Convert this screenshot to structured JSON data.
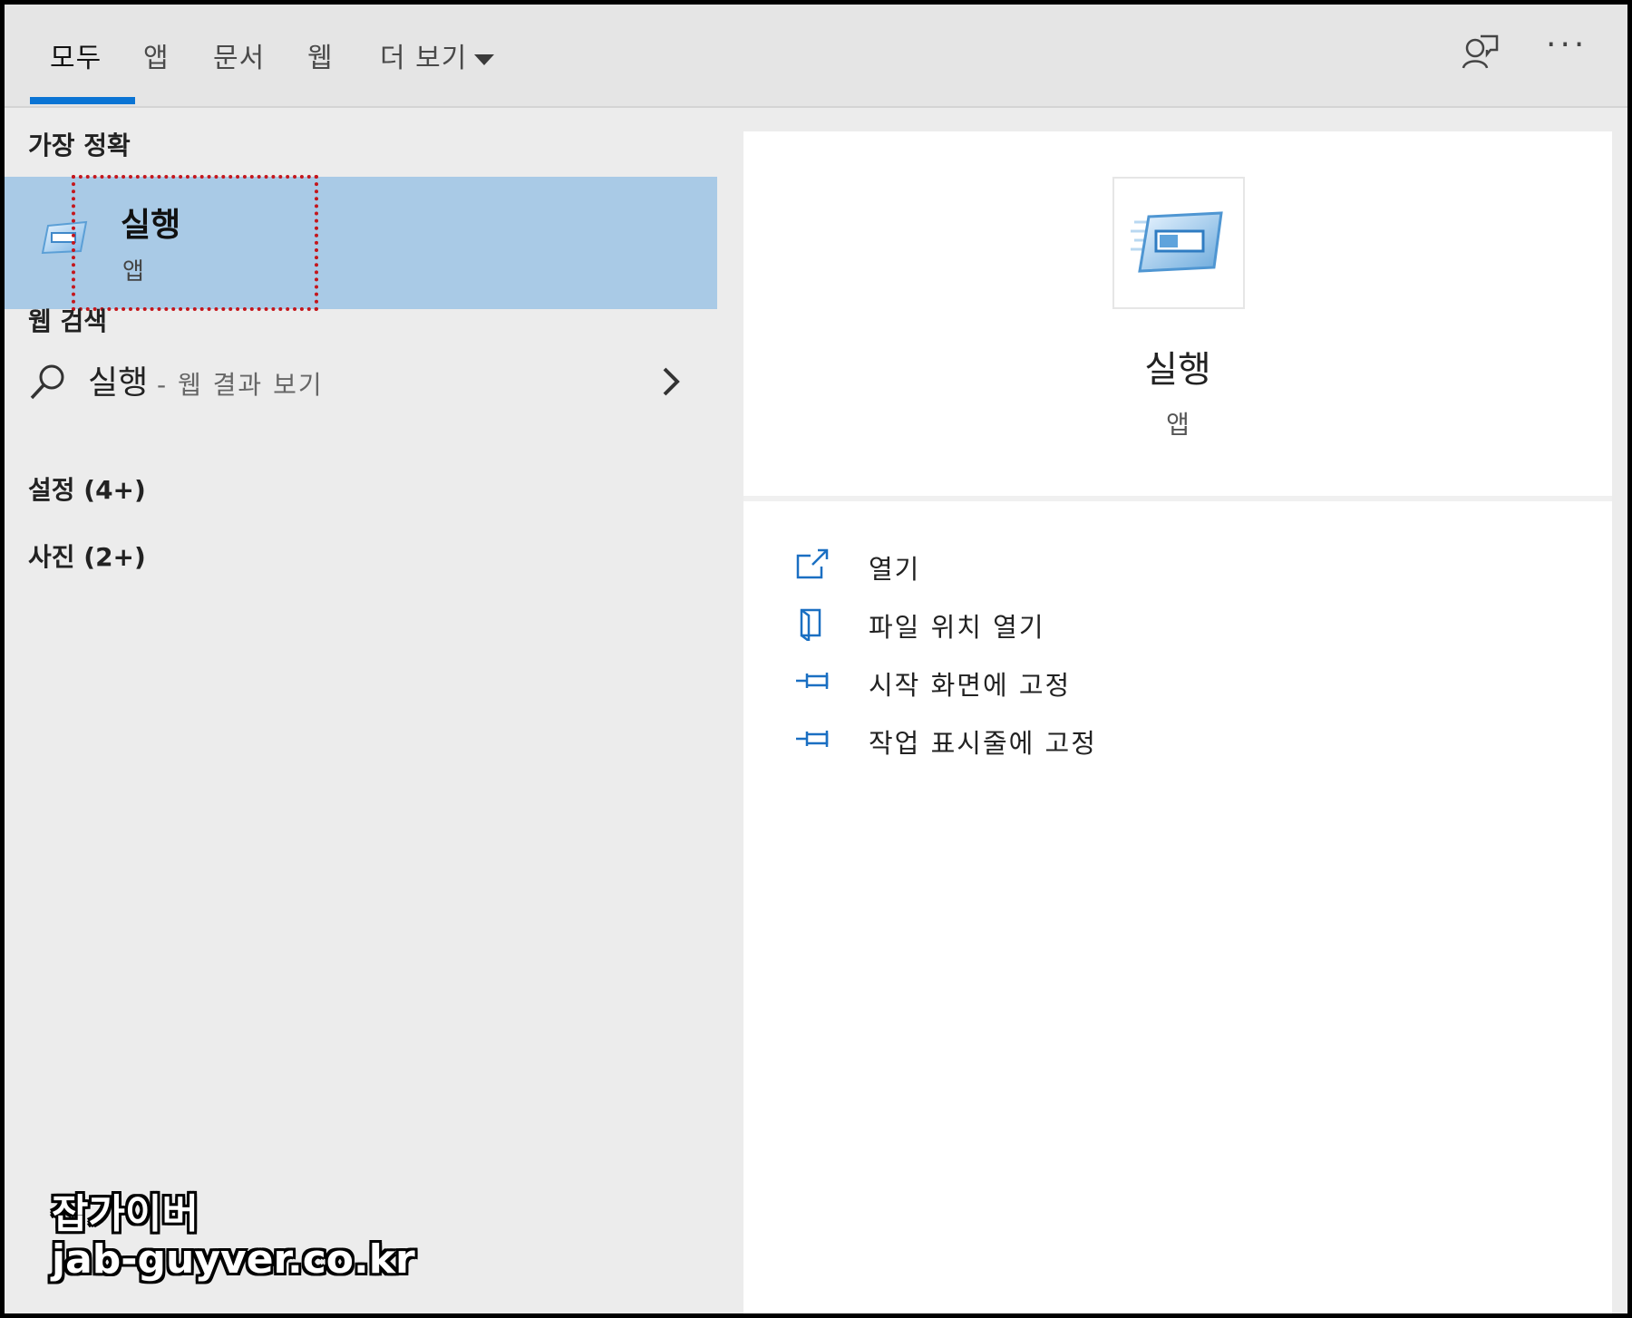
{
  "tabs": [
    {
      "label": "모두",
      "active": true
    },
    {
      "label": "앱",
      "active": false
    },
    {
      "label": "문서",
      "active": false
    },
    {
      "label": "웹",
      "active": false
    },
    {
      "label": "더 보기",
      "active": false
    }
  ],
  "toolbar": {
    "feedback_icon": "feedback-person-icon",
    "more_label": "···"
  },
  "left": {
    "best_match_heading": "가장 정확",
    "best_match": {
      "title": "실행",
      "subtitle": "앱",
      "icon": "run-app-icon"
    },
    "web_heading": "웹 검색",
    "web_search": {
      "query": "실행",
      "hint": "- 웹 결과 보기"
    },
    "groups": [
      {
        "label": "설정 (4+)"
      },
      {
        "label": "사진 (2+)"
      }
    ]
  },
  "right": {
    "title": "실행",
    "subtitle": "앱",
    "actions": [
      {
        "label": "열기",
        "icon": "open-external-icon"
      },
      {
        "label": "파일 위치 열기",
        "icon": "file-location-icon"
      },
      {
        "label": "시작 화면에 고정",
        "icon": "pin-icon"
      },
      {
        "label": "작업 표시줄에 고정",
        "icon": "pin-icon"
      }
    ]
  },
  "watermark": {
    "name": "잡가이버",
    "url": "jab-guyver.co.kr"
  },
  "colors": {
    "accent": "#0a74d4",
    "selection": "#a9cae6",
    "highlight_box": "#c4161c"
  }
}
